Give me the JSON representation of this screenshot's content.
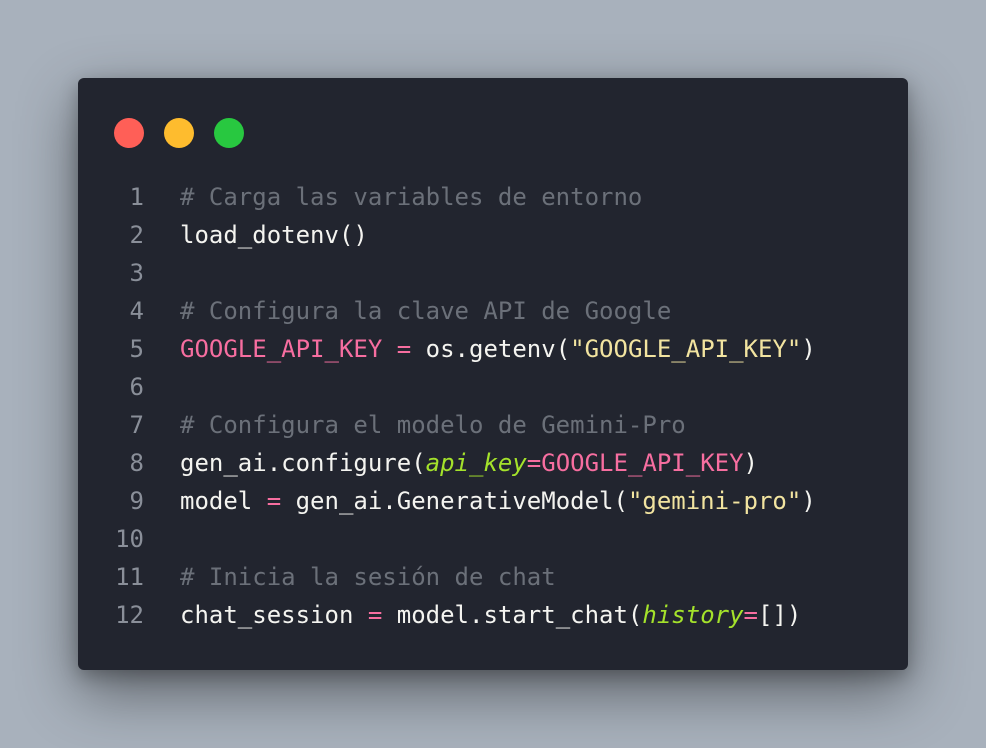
{
  "window": {
    "controls": [
      {
        "name": "close-button",
        "color": "#ff5f57"
      },
      {
        "name": "minimize-button",
        "color": "#febc2e"
      },
      {
        "name": "maximize-button",
        "color": "#28c840"
      }
    ]
  },
  "code": {
    "lines": [
      {
        "number": "1",
        "tokens": [
          {
            "type": "comment",
            "text": "# Carga las variables de entorno"
          }
        ]
      },
      {
        "number": "2",
        "tokens": [
          {
            "type": "plain",
            "text": "load_dotenv()"
          }
        ]
      },
      {
        "number": "3",
        "tokens": []
      },
      {
        "number": "4",
        "tokens": [
          {
            "type": "comment",
            "text": "# Configura la clave API de Google"
          }
        ]
      },
      {
        "number": "5",
        "tokens": [
          {
            "type": "var",
            "text": "GOOGLE_API_KEY"
          },
          {
            "type": "plain",
            "text": " "
          },
          {
            "type": "op",
            "text": "="
          },
          {
            "type": "plain",
            "text": " os.getenv("
          },
          {
            "type": "str",
            "text": "\"GOOGLE_API_KEY\""
          },
          {
            "type": "plain",
            "text": ")"
          }
        ]
      },
      {
        "number": "6",
        "tokens": []
      },
      {
        "number": "7",
        "tokens": [
          {
            "type": "comment",
            "text": "# Configura el modelo de Gemini-Pro"
          }
        ]
      },
      {
        "number": "8",
        "tokens": [
          {
            "type": "plain",
            "text": "gen_ai.configure("
          },
          {
            "type": "kw",
            "text": "api_key"
          },
          {
            "type": "op",
            "text": "="
          },
          {
            "type": "var",
            "text": "GOOGLE_API_KEY"
          },
          {
            "type": "plain",
            "text": ")"
          }
        ]
      },
      {
        "number": "9",
        "tokens": [
          {
            "type": "plain",
            "text": "model "
          },
          {
            "type": "op",
            "text": "="
          },
          {
            "type": "plain",
            "text": " gen_ai.GenerativeModel("
          },
          {
            "type": "str",
            "text": "\"gemini-pro\""
          },
          {
            "type": "plain",
            "text": ")"
          }
        ]
      },
      {
        "number": "10",
        "tokens": []
      },
      {
        "number": "11",
        "tokens": [
          {
            "type": "comment",
            "text": "# Inicia la sesión de chat"
          }
        ]
      },
      {
        "number": "12",
        "tokens": [
          {
            "type": "plain",
            "text": "chat_session "
          },
          {
            "type": "op",
            "text": "="
          },
          {
            "type": "plain",
            "text": " model.start_chat("
          },
          {
            "type": "kw",
            "text": "history"
          },
          {
            "type": "op",
            "text": "="
          },
          {
            "type": "plain",
            "text": "[])"
          }
        ]
      }
    ]
  }
}
